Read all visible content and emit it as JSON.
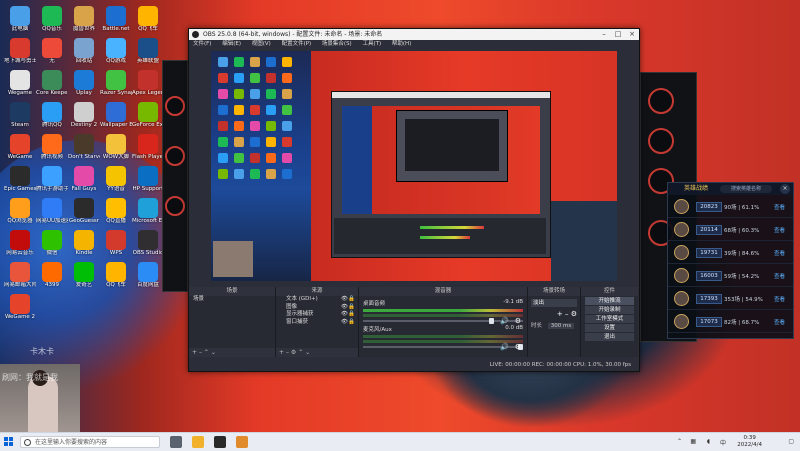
{
  "desktop": {
    "icons": [
      {
        "label": "此电脑",
        "color": "#4aa0e8"
      },
      {
        "label": "QQ音乐",
        "color": "#1db954"
      },
      {
        "label": "魔兽世界",
        "color": "#d9a34a"
      },
      {
        "label": "Battle.net",
        "color": "#1c6fd1"
      },
      {
        "label": "QQ飞车",
        "color": "#ffb400"
      },
      {
        "label": "地下城与勇士",
        "color": "#d83a2e"
      },
      {
        "label": "无",
        "color": "#ee4a3a"
      },
      {
        "label": "回收站",
        "color": "#7aa3d0"
      },
      {
        "label": "QQ游戏",
        "color": "#4ab3ff"
      },
      {
        "label": "英雄联盟",
        "color": "#1a4f8a"
      },
      {
        "label": "Wegame",
        "color": "#e4e4e4"
      },
      {
        "label": "Core Keeper D...",
        "color": "#3c8c5a"
      },
      {
        "label": "Uplay",
        "color": "#1b7bd6"
      },
      {
        "label": "Razer Synapse",
        "color": "#41c242"
      },
      {
        "label": "Apex Legends",
        "color": "#c3312c"
      },
      {
        "label": "Steam",
        "color": "#1d3b62"
      },
      {
        "label": "腾讯QQ",
        "color": "#2a9df4"
      },
      {
        "label": "Destiny 2",
        "color": "#cfcfcf"
      },
      {
        "label": "Wallpaper Engine",
        "color": "#2e6dd6"
      },
      {
        "label": "GeForce Experience",
        "color": "#76b900"
      },
      {
        "label": "WeGame",
        "color": "#e6432b"
      },
      {
        "label": "腾讯视频",
        "color": "#ff6a1a"
      },
      {
        "label": "Don't Starve Together",
        "color": "#4a3a2a"
      },
      {
        "label": "WOW大脚",
        "color": "#f3c13a"
      },
      {
        "label": "Flash Player",
        "color": "#d8261c"
      },
      {
        "label": "Epic Games",
        "color": "#2b2b2b"
      },
      {
        "label": "腾讯手游助手",
        "color": "#3ba0ff"
      },
      {
        "label": "Fall Guys",
        "color": "#e44ba8"
      },
      {
        "label": "YY语音",
        "color": "#f6c300"
      },
      {
        "label": "HP Support",
        "color": "#0a6fc2"
      },
      {
        "label": "QQ浏览器",
        "color": "#ff9e1b"
      },
      {
        "label": "网易UU加速器",
        "color": "#2f7cf6"
      },
      {
        "label": "GeoGuessr",
        "color": "#2b2b2b"
      },
      {
        "label": "QQ直播",
        "color": "#ffbf00"
      },
      {
        "label": "Microsoft Edge",
        "color": "#1fa0d9"
      },
      {
        "label": "网易云音乐",
        "color": "#c20c0c"
      },
      {
        "label": "微信",
        "color": "#2dc100"
      },
      {
        "label": "Kindle",
        "color": "#f4b400"
      },
      {
        "label": "WPS",
        "color": "#d33a2c"
      },
      {
        "label": "OBS Studio",
        "color": "#302e31"
      },
      {
        "label": "网易邮箱大师",
        "color": "#e8553a"
      },
      {
        "label": "4399",
        "color": "#ff6a00"
      },
      {
        "label": "爱奇艺",
        "color": "#00be06"
      },
      {
        "label": "QQ飞车",
        "color": "#ffb400"
      },
      {
        "label": "百度网盘",
        "color": "#2a8cf4"
      },
      {
        "label": "WeGame 2",
        "color": "#e6432b"
      }
    ]
  },
  "obs": {
    "title": "OBS 25.0.8 (64-bit, windows) - 配置文件: 未命名 - 场景: 未命名",
    "menu": [
      "文件(F)",
      "编辑(E)",
      "视图(V)",
      "配置文件(P)",
      "场景集合(S)",
      "工具(T)",
      "帮助(H)"
    ],
    "docks": {
      "scenes": {
        "header": "场景",
        "items": [
          "场景"
        ]
      },
      "sources": {
        "header": "来源",
        "items": [
          "文本 (GDI+)",
          "图像",
          "显示器捕获",
          "窗口捕获"
        ]
      },
      "mixer": {
        "header": "混音器",
        "channels": [
          {
            "name": "桌面音频",
            "db": "-9.1 dB"
          },
          {
            "name": "麦克风/Aux",
            "db": "0.0 dB"
          }
        ]
      },
      "transitions": {
        "header": "场景转场",
        "type": "淡出",
        "duration_label": "时长",
        "duration": "300 ms"
      },
      "controls": {
        "header": "控件",
        "buttons": [
          "开始推流",
          "开始录制",
          "工作室模式",
          "设置",
          "退出"
        ]
      }
    },
    "status": "LIVE: 00:00:00   REC: 00:00:00   CPU: 1.0%, 30.00 fps"
  },
  "hero_panel": {
    "title": "英雄战绩",
    "search_placeholder": "搜索英雄名称",
    "close": "×",
    "rows": [
      {
        "score": "20823",
        "stats": "90场 | 61.1%",
        "action": "查看"
      },
      {
        "score": "20114",
        "stats": "68场 | 60.3%",
        "action": "查看"
      },
      {
        "score": "19731",
        "stats": "39场 | 84.6%",
        "action": "查看"
      },
      {
        "score": "16003",
        "stats": "59场 | 54.2%",
        "action": "查看"
      },
      {
        "score": "17393",
        "stats": "353场 | 54.9%",
        "action": "查看"
      },
      {
        "score": "17073",
        "stats": "82场 | 68.7%",
        "action": "查看"
      }
    ]
  },
  "watermark": {
    "line1": "卡木卡",
    "line2": "刷网：我就是我"
  },
  "taskbar": {
    "search_placeholder": "在这里输入你要搜索的内容",
    "time": "0:39",
    "date": "2022/4/4",
    "lang": "中",
    "apps": [
      {
        "name": "task-view",
        "color": "#5a6270"
      },
      {
        "name": "file-explorer",
        "color": "#f2b12b"
      },
      {
        "name": "obs",
        "color": "#2a2a2a"
      },
      {
        "name": "wegame",
        "color": "#e08a2b"
      }
    ]
  },
  "colors": {
    "accent_red": "#e33a27",
    "obs_bg": "#2b2e38",
    "hero_gold": "#e8c15a",
    "link_blue": "#5ab1ff"
  }
}
